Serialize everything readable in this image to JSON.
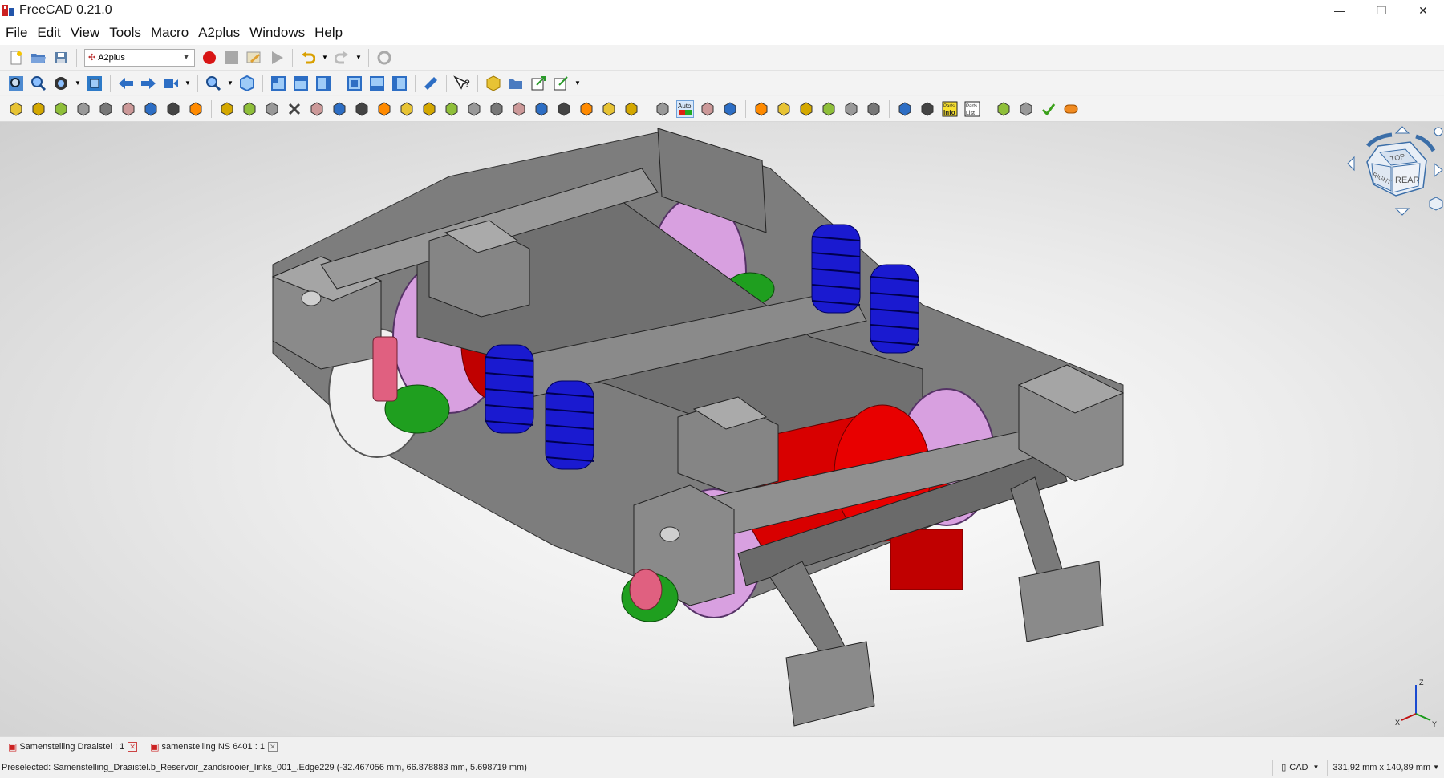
{
  "window": {
    "title": "FreeCAD 0.21.0",
    "minimize": "—",
    "maximize": "❐",
    "close": "✕"
  },
  "menu": [
    "File",
    "Edit",
    "View",
    "Tools",
    "Macro",
    "A2plus",
    "Windows",
    "Help"
  ],
  "toolbar": {
    "workbench_selected": "A2plus",
    "auto_label": "Auto",
    "info_label": "Info",
    "list_label": "List",
    "parts_label": "Parts"
  },
  "navcube": {
    "top": "TOP",
    "right": "RIGHT",
    "rear": "REAR"
  },
  "axes": {
    "x": "X",
    "y": "Y",
    "z": "Z"
  },
  "doc_tabs": [
    {
      "label": "Samenstelling Draaistel : 1"
    },
    {
      "label": "samenstelling NS 6401 : 1"
    }
  ],
  "status": {
    "message": "Preselected: Samenstelling_Draaistel.b_Reservoir_zandsrooier_links_001_.Edge229 (-32.467056 mm, 66.878883 mm, 5.698719 mm)",
    "nav_style": "CAD",
    "dimensions": "331,92 mm x 140,89 mm"
  },
  "colors": {
    "frame": "#6e6e6e",
    "motor": "#d80000",
    "springs": "#1a1ad0",
    "wheels": "#d8a0e0",
    "brake": "#1f9f1f",
    "cylinder": "#e06080"
  }
}
